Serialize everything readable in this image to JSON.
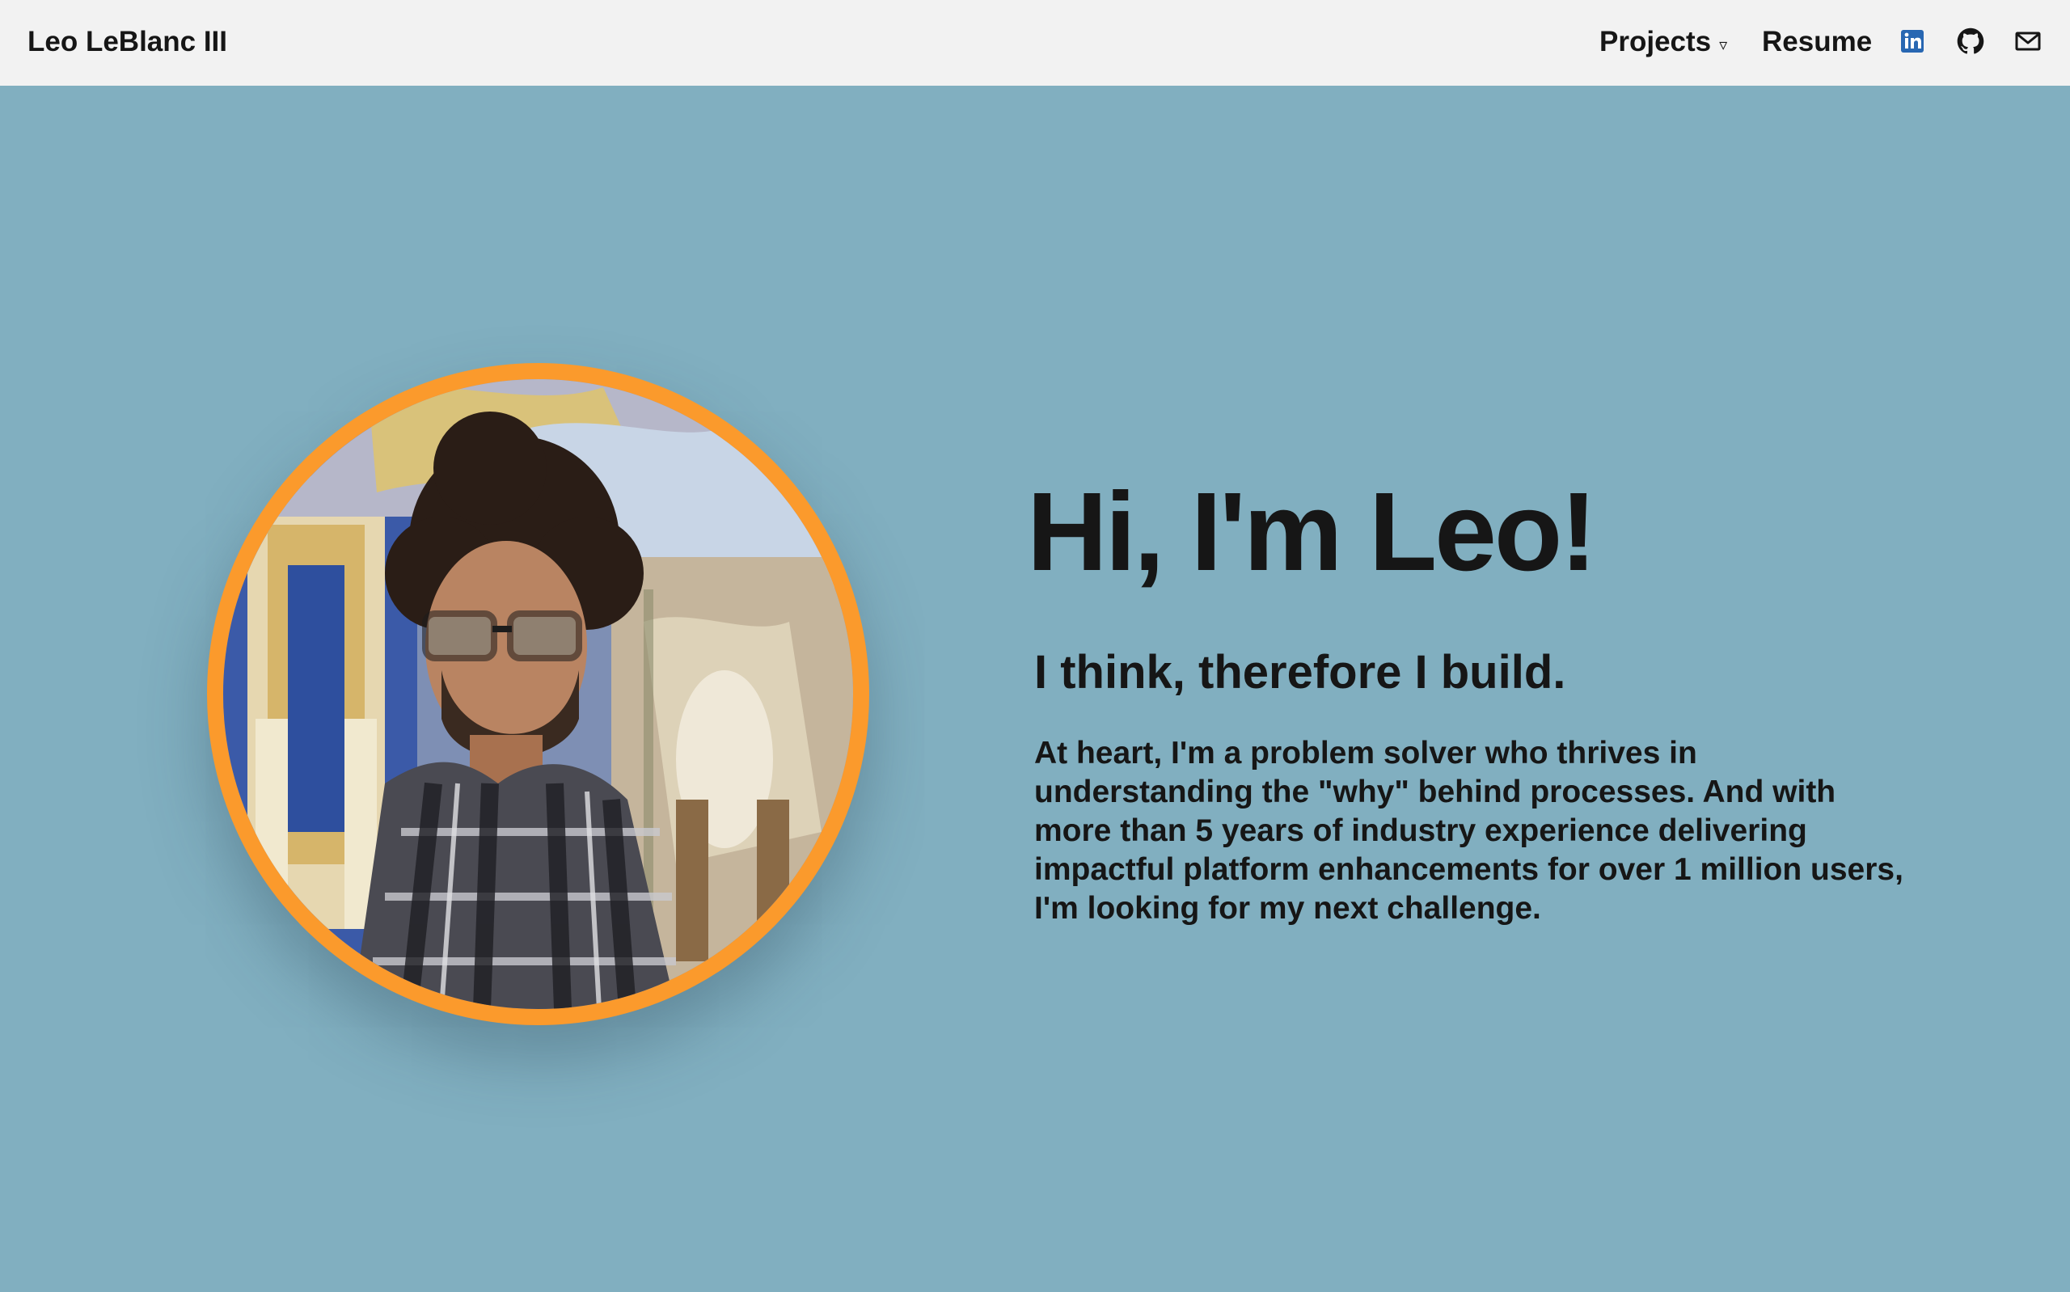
{
  "header": {
    "brand": "Leo LeBlanc III",
    "nav": {
      "projects_label": "Projects",
      "projects_caret": "▿",
      "resume_label": "Resume"
    },
    "social_icons": [
      "linkedin-icon",
      "github-icon",
      "mail-icon"
    ]
  },
  "hero": {
    "title": "Hi, I'm Leo!",
    "subtitle": "I think, therefore I build.",
    "body": "At heart, I'm a problem solver who thrives in understanding the \"why\" behind processes. And with more than 5 years of industry experience delivering impactful platform enhancements for over 1 million users, I'm looking for my next challenge."
  },
  "colors": {
    "header_bg": "#f2f2f2",
    "page_bg": "#81afc0",
    "portrait_ring": "#fb9a2c",
    "text": "#161616",
    "linkedin_blue": "#2867b2"
  }
}
